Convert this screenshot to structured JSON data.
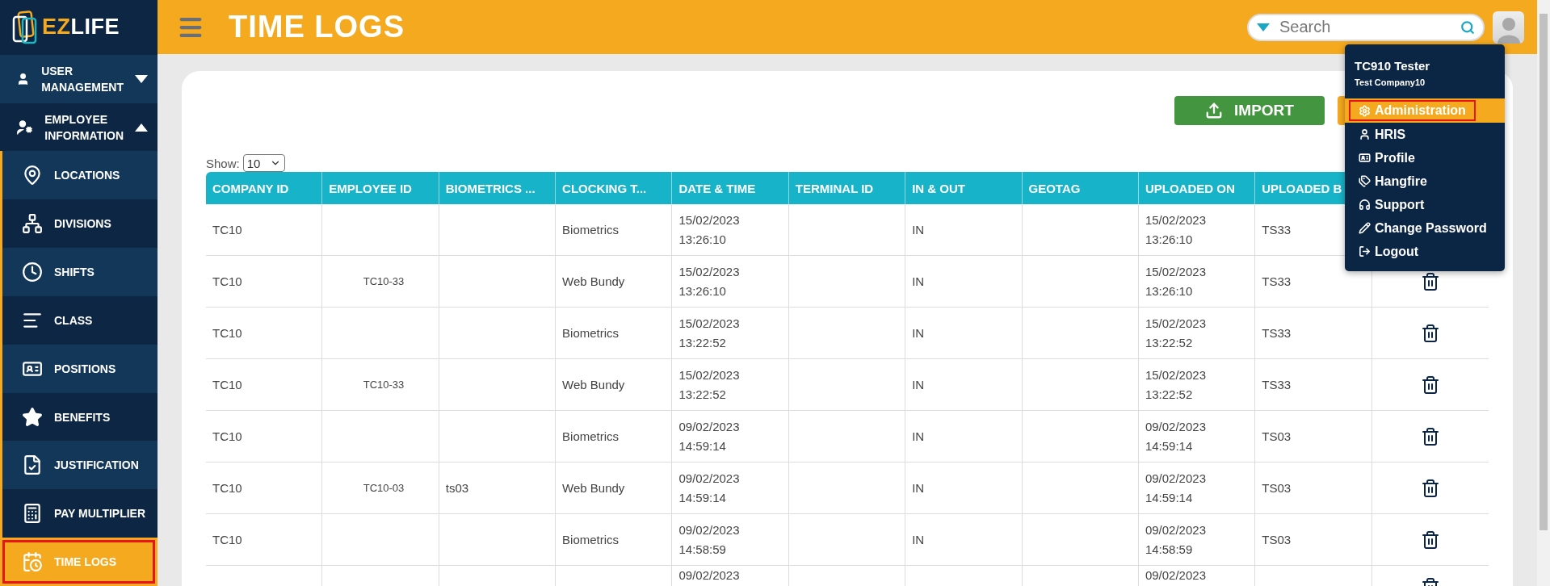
{
  "sidebar": {
    "logo": {
      "prefix": "EZ",
      "suffix": "LIFE"
    },
    "items": [
      {
        "label": "USER MANAGEMENT",
        "expanded": false
      },
      {
        "label": "EMPLOYEE INFORMATION",
        "expanded": true,
        "children": [
          {
            "label": "LOCATIONS",
            "selected": false,
            "highlighted": false
          },
          {
            "label": "DIVISIONS",
            "selected": false,
            "highlighted": false
          },
          {
            "label": "SHIFTS",
            "selected": false,
            "highlighted": false
          },
          {
            "label": "CLASS",
            "selected": false,
            "highlighted": false
          },
          {
            "label": "POSITIONS",
            "selected": false,
            "highlighted": false
          },
          {
            "label": "BENEFITS",
            "selected": false,
            "highlighted": false
          },
          {
            "label": "JUSTIFICATION",
            "selected": false,
            "highlighted": false
          },
          {
            "label": "PAY MULTIPLIER",
            "selected": false,
            "highlighted": false
          },
          {
            "label": "TIME LOGS",
            "selected": true,
            "highlighted": true
          }
        ]
      }
    ]
  },
  "header": {
    "title": "TIME LOGS",
    "search": {
      "placeholder": "Search"
    }
  },
  "toolbar": {
    "import_button": "IMPORT"
  },
  "show": {
    "label": "Show:",
    "value": "10"
  },
  "table": {
    "columns": [
      "COMPANY ID",
      "EMPLOYEE ID",
      "BIOMETRICS ...",
      "CLOCKING T...",
      "DATE & TIME",
      "TERMINAL ID",
      "IN & OUT",
      "GEOTAG",
      "UPLOADED ON",
      "UPLOADED B"
    ],
    "rows": [
      {
        "cells": [
          "TC10",
          "",
          "",
          "Biometrics",
          "15/02/2023\n13:26:10",
          "",
          "IN",
          "",
          "15/02/2023\n13:26:10",
          "TS33"
        ],
        "delete_icon": false
      },
      {
        "cells": [
          "TC10",
          "TC10-33",
          "",
          "Web Bundy",
          "15/02/2023\n13:26:10",
          "",
          "IN",
          "",
          "15/02/2023\n13:26:10",
          "TS33"
        ]
      },
      {
        "cells": [
          "TC10",
          "",
          "",
          "Biometrics",
          "15/02/2023\n13:22:52",
          "",
          "IN",
          "",
          "15/02/2023\n13:22:52",
          "TS33"
        ]
      },
      {
        "cells": [
          "TC10",
          "TC10-33",
          "",
          "Web Bundy",
          "15/02/2023\n13:22:52",
          "",
          "IN",
          "",
          "15/02/2023\n13:22:52",
          "TS33"
        ]
      },
      {
        "cells": [
          "TC10",
          "",
          "",
          "Biometrics",
          "09/02/2023\n14:59:14",
          "",
          "IN",
          "",
          "09/02/2023\n14:59:14",
          "TS03"
        ]
      },
      {
        "cells": [
          "TC10",
          "TC10-03",
          "ts03",
          "Web Bundy",
          "09/02/2023\n14:59:14",
          "",
          "IN",
          "",
          "09/02/2023\n14:59:14",
          "TS03"
        ]
      },
      {
        "cells": [
          "TC10",
          "",
          "",
          "Biometrics",
          "09/02/2023\n14:58:59",
          "",
          "IN",
          "",
          "09/02/2023\n14:58:59",
          "TS03"
        ]
      },
      {
        "cells": [
          "",
          "",
          "",
          "",
          "09/02/2023",
          "",
          "",
          "",
          "09/02/2023",
          ""
        ]
      }
    ]
  },
  "user_menu": {
    "name": "TC910 Tester",
    "company": "Test Company10",
    "items": [
      {
        "label": "Administration",
        "selected": true,
        "highlighted": true
      },
      {
        "label": "HRIS",
        "selected": false,
        "highlighted": false
      },
      {
        "label": "Profile",
        "selected": false,
        "highlighted": false
      },
      {
        "label": "Hangfire",
        "selected": false,
        "highlighted": false
      },
      {
        "label": "Support",
        "selected": false,
        "highlighted": false
      },
      {
        "label": "Change Password",
        "selected": false,
        "highlighted": false
      },
      {
        "label": "Logout",
        "selected": false,
        "highlighted": false
      }
    ]
  }
}
